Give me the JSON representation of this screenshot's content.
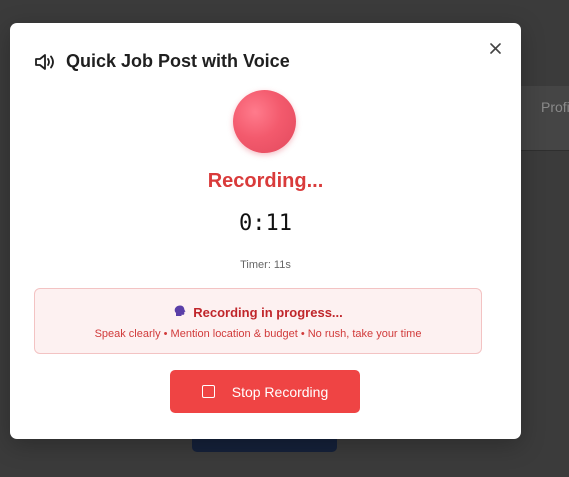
{
  "background": {
    "tab_label": "Profi"
  },
  "modal": {
    "title": "Quick Job Post with Voice",
    "close_symbol": "×",
    "status": "Recording...",
    "elapsed": "0:11",
    "timer_label": "Timer: 11s",
    "info": {
      "title": "Recording in progress...",
      "title_icon": "speaking-head-icon",
      "subtitle": "Speak clearly • Mention location & budget • No rush, take your time"
    },
    "stop_button": {
      "label": "Stop Recording",
      "icon": "stop-square-icon"
    }
  },
  "colors": {
    "accent_red": "#ef4444",
    "status_red": "#d93b3b",
    "info_bg": "#fdf1f1"
  }
}
